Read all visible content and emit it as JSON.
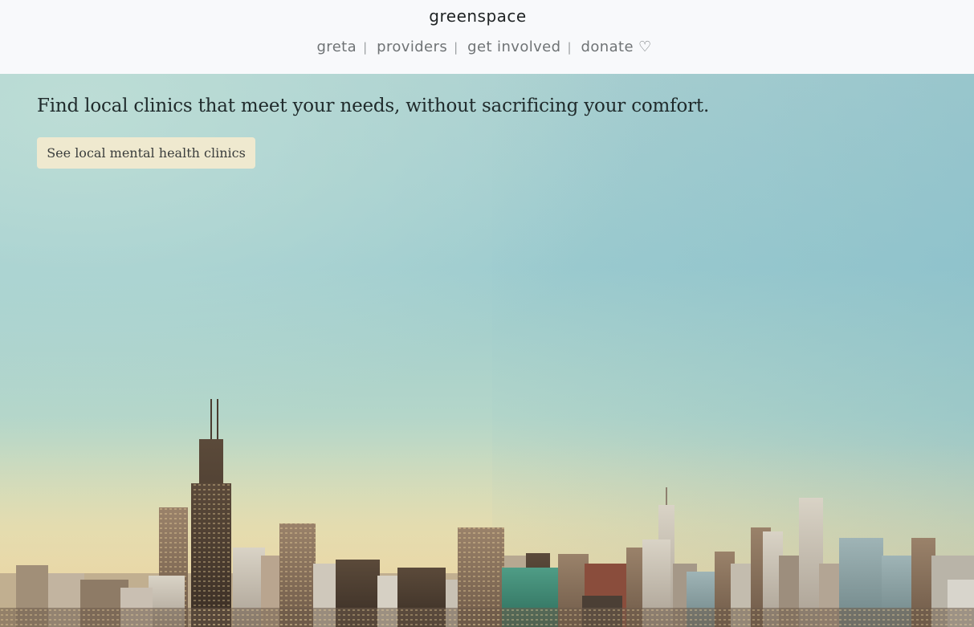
{
  "header": {
    "brand": "greenspace",
    "nav": [
      {
        "label": "greta"
      },
      {
        "label": "providers"
      },
      {
        "label": "get involved"
      },
      {
        "label": "donate"
      }
    ],
    "separator": "|",
    "heart_icon": "♡"
  },
  "hero": {
    "headline": "Find local clinics that meet your needs, without sacrificing your comfort.",
    "cta_label": "See local mental health clinics",
    "background_image": "city-skyline-photo"
  },
  "colors": {
    "header_bg": "#f8f9fb",
    "cta_bg": "#efe9cf",
    "nav_text": "#6f7375"
  }
}
